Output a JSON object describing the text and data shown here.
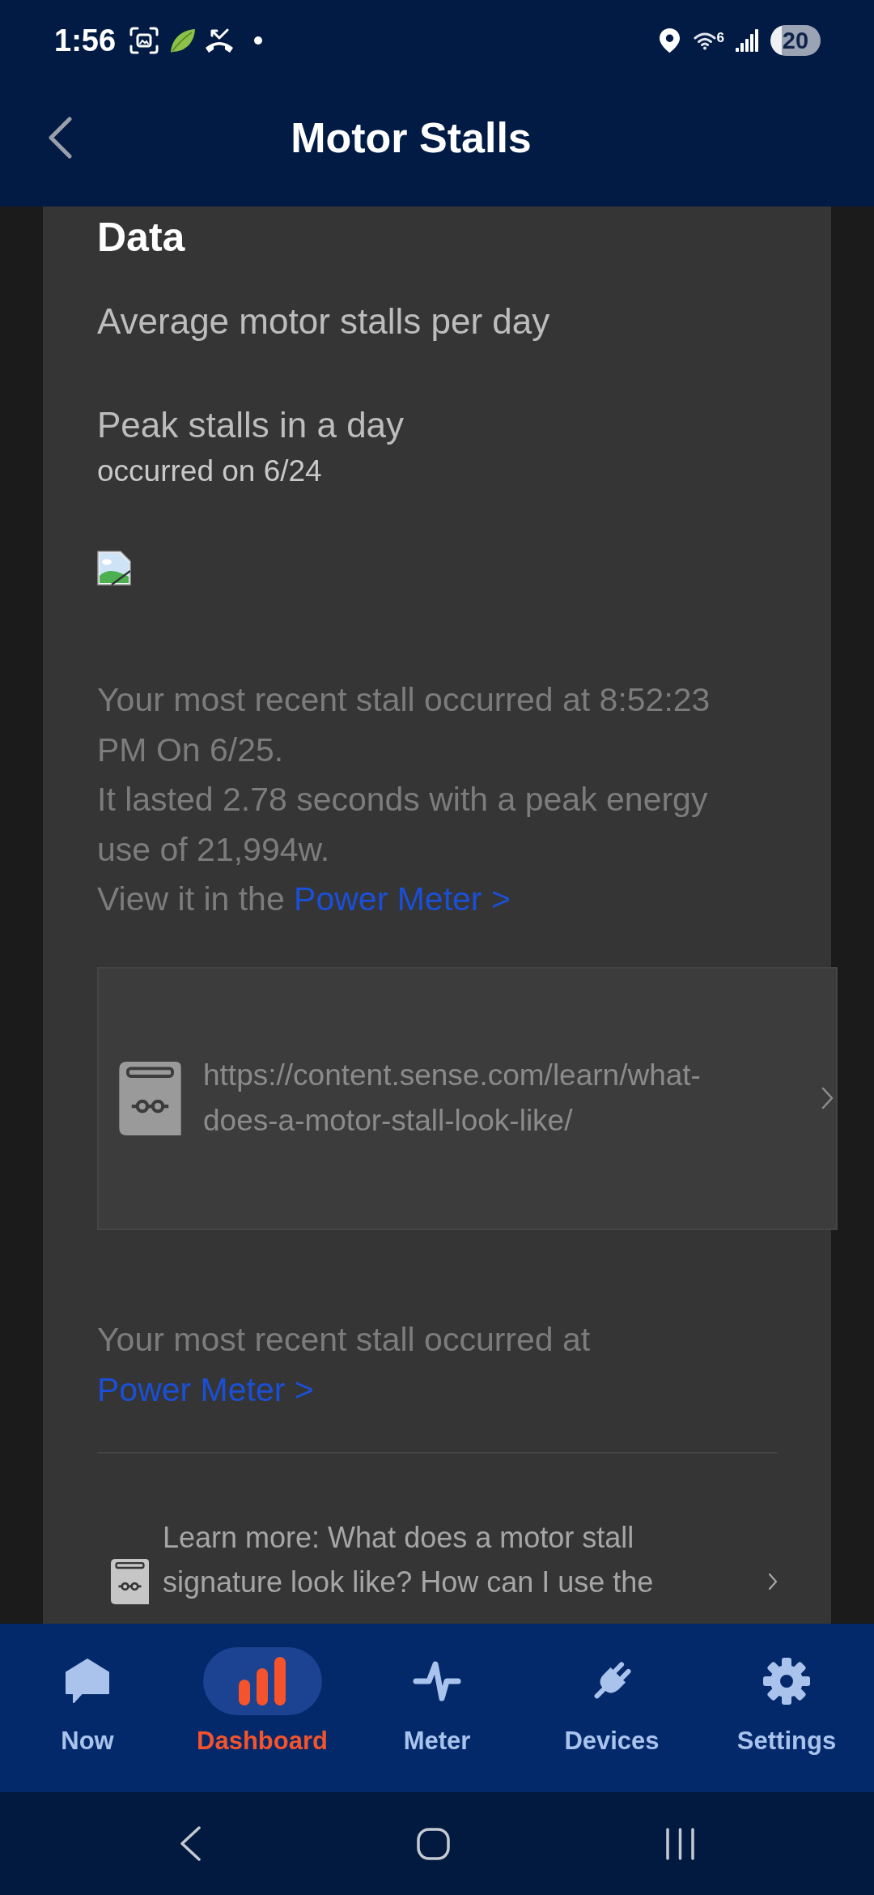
{
  "status_bar": {
    "time": "1:56",
    "network_type": "6",
    "battery": "20"
  },
  "header": {
    "title": "Motor Stalls"
  },
  "data_section": {
    "heading": "Data",
    "stats": [
      {
        "label": "Average motor stalls per day"
      },
      {
        "label": "Peak stalls in a day",
        "note": "occurred on 6/24"
      }
    ]
  },
  "recent_stall": {
    "lines": [
      "Your most recent stall occurred at 8:52:23 PM On 6/25.",
      "It lasted 2.78 seconds with a peak energy use of 21,994w."
    ],
    "prompt": "View it in the",
    "link": "Power Meter >"
  },
  "article_link": {
    "url": "https://content.sense.com/learn/what-does-a-motor-stall-look-like/"
  },
  "recent_stall_short": {
    "text": "Your most recent stall occurred at",
    "link": "Power Meter >"
  },
  "learn_more": {
    "text": "Learn more: What does a motor stall signature look like? How can I use the"
  },
  "bottom_nav": [
    {
      "label": "Now",
      "selected": false
    },
    {
      "label": "Dashboard",
      "selected": true
    },
    {
      "label": "Meter",
      "selected": false
    },
    {
      "label": "Devices",
      "selected": false
    },
    {
      "label": "Settings",
      "selected": false
    }
  ]
}
